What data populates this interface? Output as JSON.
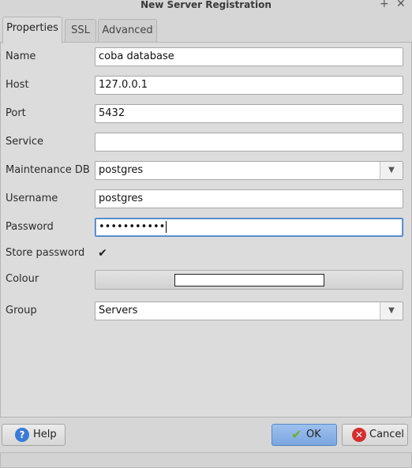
{
  "window": {
    "title": "New Server Registration",
    "pin_glyph": "+",
    "close_glyph": "✕"
  },
  "tabs": [
    {
      "label": "Properties",
      "active": true
    },
    {
      "label": "SSL",
      "active": false
    },
    {
      "label": "Advanced",
      "active": false
    }
  ],
  "form": {
    "name": {
      "label": "Name",
      "value": "coba database"
    },
    "host": {
      "label": "Host",
      "value": "127.0.0.1"
    },
    "port": {
      "label": "Port",
      "value": "5432"
    },
    "service": {
      "label": "Service",
      "value": ""
    },
    "maintenance_db": {
      "label": "Maintenance DB",
      "value": "postgres"
    },
    "username": {
      "label": "Username",
      "value": "postgres"
    },
    "password": {
      "label": "Password",
      "value": "•••••••••••"
    },
    "store_password": {
      "label": "Store password",
      "checked": true,
      "glyph": "✔"
    },
    "colour": {
      "label": "Colour",
      "value": "#ffffff"
    },
    "group": {
      "label": "Group",
      "value": "Servers"
    }
  },
  "buttons": {
    "help": {
      "label": "Help",
      "icon": "question-icon",
      "glyph": "?"
    },
    "ok": {
      "label": "OK",
      "icon": "checkmark-icon",
      "glyph": "✔"
    },
    "cancel": {
      "label": "Cancel",
      "icon": "cancel-icon",
      "glyph": "✕"
    }
  },
  "colors": {
    "accent": "#7aa6df",
    "help_icon": "#3a7bd5",
    "ok_icon": "#8bc34a",
    "cancel_icon": "#d32f2f"
  }
}
